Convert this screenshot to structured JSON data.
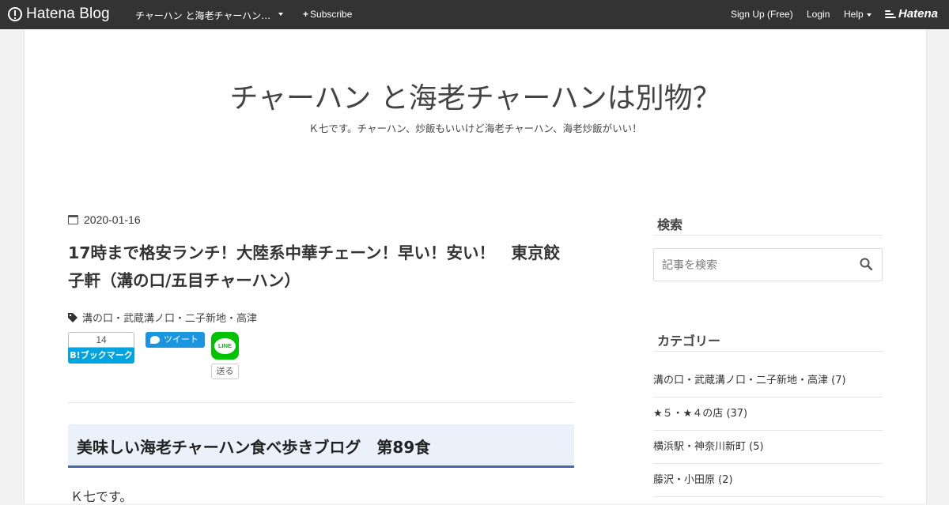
{
  "topbar": {
    "logo_text": "Hatena Blog",
    "blog_select": "チャーハン と海老チャーハン…",
    "subscribe": "Subscribe",
    "signup": "Sign Up (Free)",
    "login": "Login",
    "help": "Help",
    "brand": "Hatena"
  },
  "blog": {
    "title": "チャーハン と海老チャーハンは別物？",
    "description": "Ｋ七です。チャーハン、炒飯もいいけど海老チャーハン、海老炒飯がいい！"
  },
  "entry": {
    "date": "2020-01-16",
    "title": "17時まで格安ランチ！大陸系中華チェーン！早い！安い！　東京餃子軒（溝の口/五目チャーハン）",
    "category": "溝の口・武蔵溝ノ口・二子新地・高津",
    "hatebu_count": "14",
    "hatebu_label": "B!ブックマーク",
    "tweet_label": "ツイート",
    "line_label": "LINE",
    "line_send": "送る",
    "section_heading": "美味しい海老チャーハン食べ歩きブログ　第89食",
    "body_first_line": "Ｋ七です。"
  },
  "sidebar": {
    "search_title": "検索",
    "search_placeholder": "記事を検索",
    "category_title": "カテゴリー",
    "categories": [
      {
        "label": "溝の口・武蔵溝ノ口・二子新地・高津 (7)"
      },
      {
        "label": "★５・★４の店 (37)"
      },
      {
        "label": "横浜駅・神奈川新町 (5)"
      },
      {
        "label": "藤沢・小田原 (2)"
      }
    ]
  },
  "colors": {
    "topbar": "#333333",
    "hatebu": "#00a4de",
    "twitter": "#1b95e0",
    "line": "#00c300",
    "section_border": "#4a6aa5",
    "section_bg": "#eaf1fb"
  }
}
